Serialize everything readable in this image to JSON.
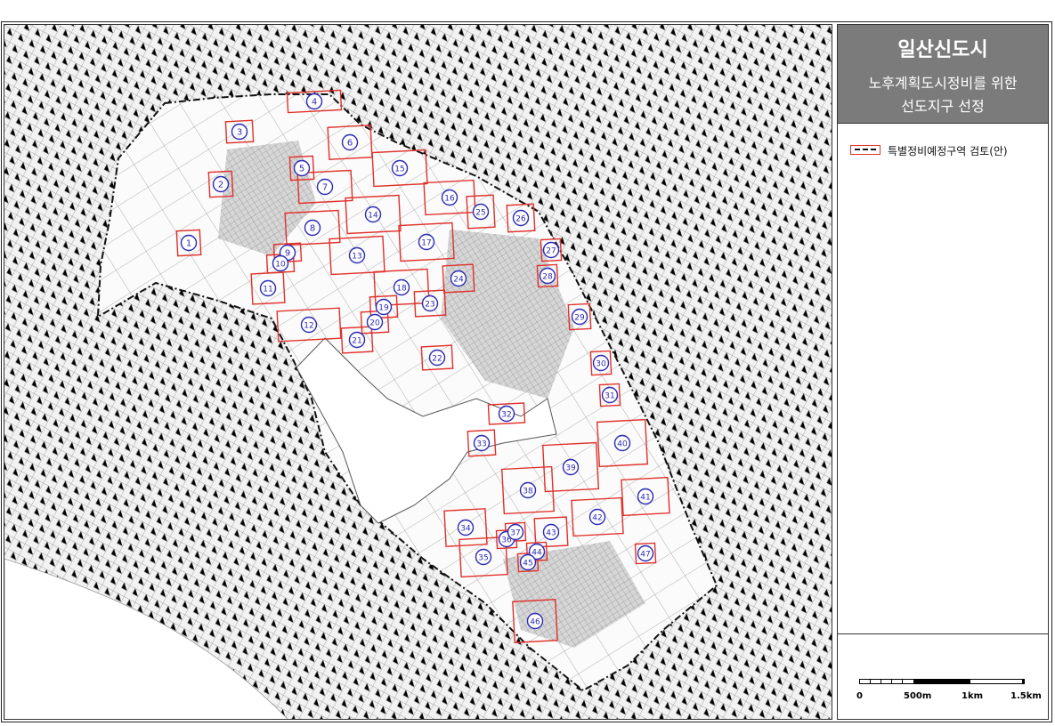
{
  "panel": {
    "title": "일산신도시",
    "subtitle_line1": "노후계획도시정비를 위한",
    "subtitle_line2": "선도지구 선정",
    "legend_label": "특별정비예정구역 검토(안)"
  },
  "scale_bar": {
    "labels": [
      "0",
      "500m",
      "1km",
      "1.5km"
    ]
  },
  "colors": {
    "zone_outline": "#e0302a",
    "marker_outline": "#2a2ab5",
    "boundary": "#111111",
    "panel_header": "#7b7b7b"
  },
  "map": {
    "zone_markers": [
      "1",
      "2",
      "3",
      "4",
      "5",
      "6",
      "7",
      "8",
      "9",
      "10",
      "11",
      "12",
      "13",
      "14",
      "15",
      "16",
      "17",
      "18",
      "19",
      "20",
      "21",
      "22",
      "23",
      "24",
      "25",
      "26",
      "27",
      "28",
      "29",
      "30",
      "31",
      "32",
      "33",
      "34",
      "35",
      "36",
      "37",
      "38",
      "39",
      "40",
      "41",
      "42",
      "43",
      "44",
      "45",
      "46",
      "47"
    ]
  }
}
